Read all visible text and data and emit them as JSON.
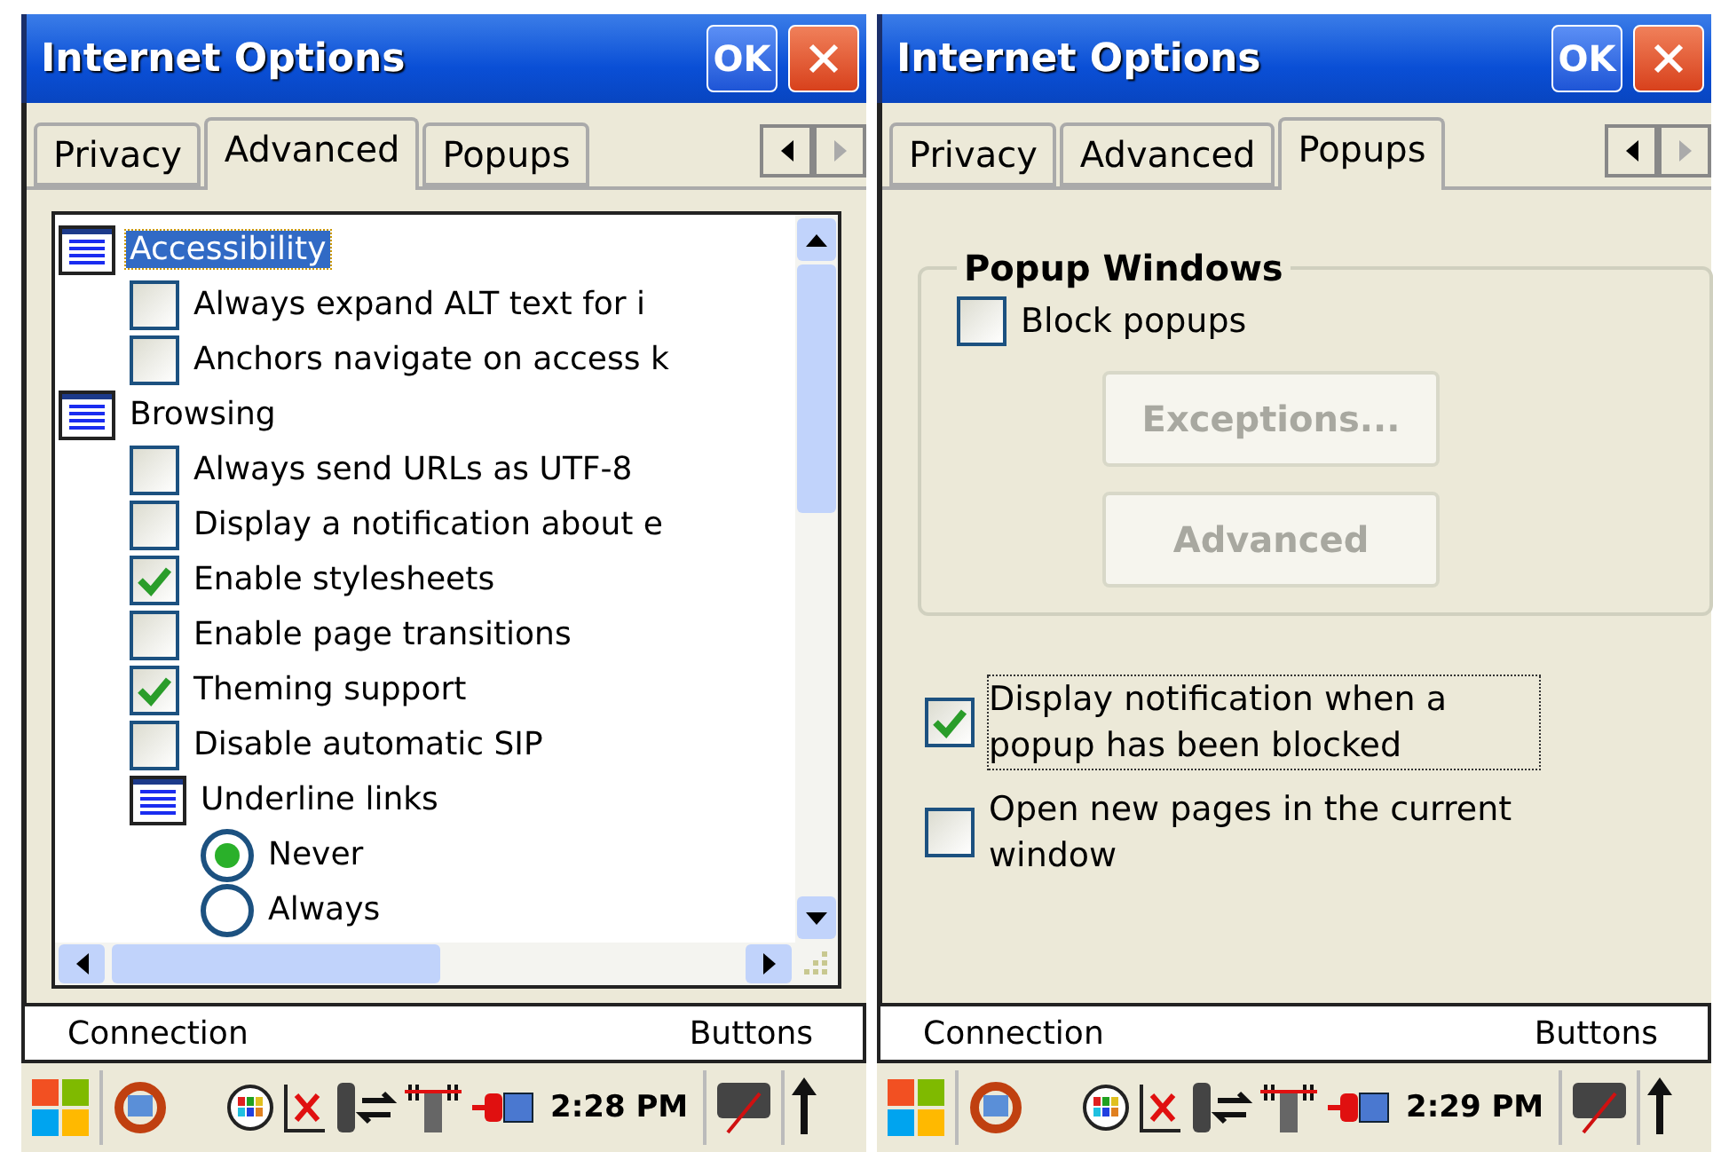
{
  "panels": [
    {
      "window": {
        "title": "Internet Options",
        "ok": "OK"
      },
      "tabs": [
        {
          "label": "Privacy",
          "selected": false
        },
        {
          "label": "Advanced",
          "selected": true
        },
        {
          "label": "Popups",
          "selected": false
        }
      ],
      "content": {
        "kind": "tree",
        "items": [
          {
            "kind": "group",
            "label": "Accessibility",
            "selected": true,
            "children": [
              {
                "kind": "checkbox",
                "label": "Always expand ALT text for i",
                "checked": false
              },
              {
                "kind": "checkbox",
                "label": "Anchors navigate on access k",
                "checked": false
              }
            ]
          },
          {
            "kind": "group",
            "label": "Browsing",
            "selected": false,
            "children": [
              {
                "kind": "checkbox",
                "label": "Always send URLs as UTF-8",
                "checked": false
              },
              {
                "kind": "checkbox",
                "label": "Display a notification about e",
                "checked": false
              },
              {
                "kind": "checkbox",
                "label": "Enable stylesheets",
                "checked": true
              },
              {
                "kind": "checkbox",
                "label": "Enable page transitions",
                "checked": false
              },
              {
                "kind": "checkbox",
                "label": "Theming support",
                "checked": true
              },
              {
                "kind": "checkbox",
                "label": "Disable automatic SIP",
                "checked": false
              },
              {
                "kind": "group",
                "label": "Underline links",
                "selected": false,
                "children": [
                  {
                    "kind": "radio",
                    "label": "Never",
                    "checked": true
                  },
                  {
                    "kind": "radio",
                    "label": "Always",
                    "checked": false
                  }
                ]
              }
            ]
          }
        ]
      },
      "bottom_tabs": [
        "Connection",
        "Buttons"
      ],
      "taskbar": {
        "time": "2:28 PM"
      }
    },
    {
      "window": {
        "title": "Internet Options",
        "ok": "OK"
      },
      "tabs": [
        {
          "label": "Privacy",
          "selected": false
        },
        {
          "label": "Advanced",
          "selected": false
        },
        {
          "label": "Popups",
          "selected": true
        }
      ],
      "content": {
        "kind": "popups",
        "group_title": "Popup Windows",
        "block": {
          "label": "Block popups",
          "checked": false
        },
        "buttons": [
          {
            "label": "Exceptions...",
            "disabled": true
          },
          {
            "label": "Advanced",
            "disabled": true
          }
        ],
        "options": [
          {
            "label": "Display notification when a popup has been blocked",
            "checked": true,
            "focused": true
          },
          {
            "label": "Open new pages in the current window",
            "checked": false,
            "focused": false
          }
        ]
      },
      "bottom_tabs": [
        "Connection",
        "Buttons"
      ],
      "taskbar": {
        "time": "2:29 PM"
      }
    }
  ]
}
